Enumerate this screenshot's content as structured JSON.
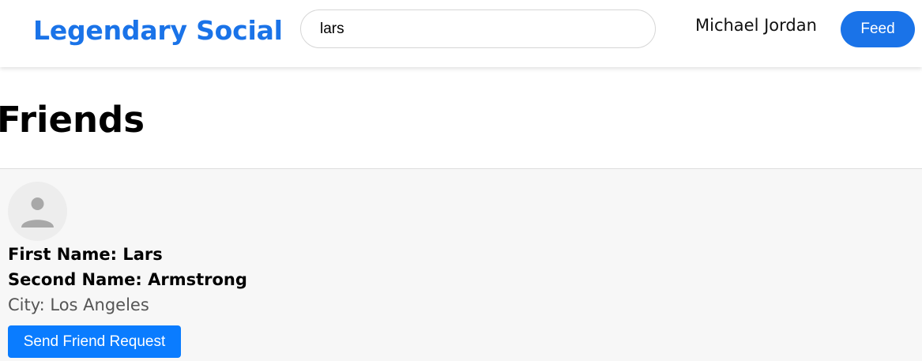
{
  "header": {
    "logo": "Legendary Social",
    "search_value": "lars",
    "user_name": "Michael Jordan",
    "feed_label": "Feed"
  },
  "page": {
    "title": "Friends"
  },
  "results": [
    {
      "avatar_icon": "person-icon",
      "first_name": "First Name: Lars",
      "second_name": "Second Name: Armstrong",
      "city": "City: Los Angeles",
      "action_label": "Send Friend Request"
    }
  ],
  "colors": {
    "brand": "#1a73e8",
    "action": "#0a7cff",
    "card_bg": "#f7f7f7"
  }
}
